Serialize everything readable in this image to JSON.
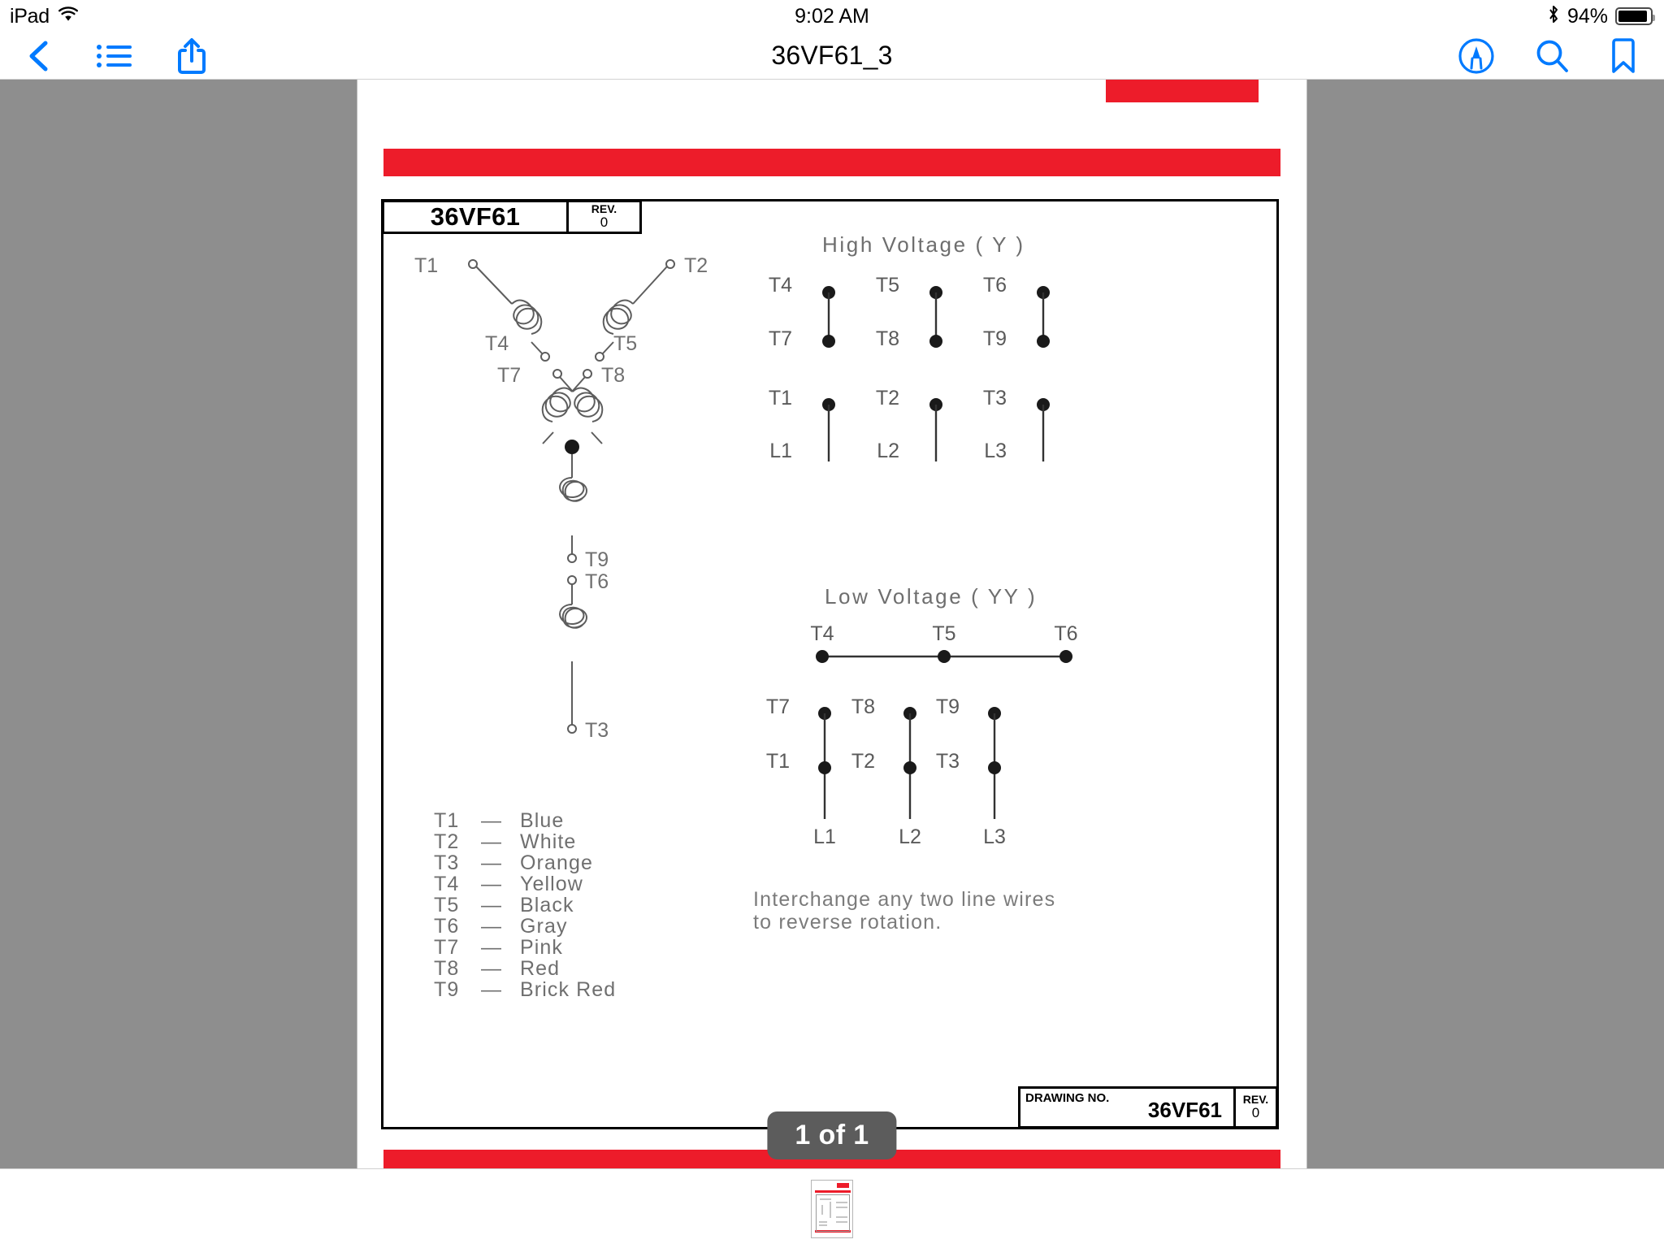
{
  "status_bar": {
    "carrier": "iPad",
    "wifi_icon": "wifi-icon",
    "time": "9:02 AM",
    "bluetooth_icon": "bluetooth-icon",
    "battery_percent": "94%",
    "battery_icon": "battery-icon"
  },
  "toolbar": {
    "back_icon": "back-chevron-icon",
    "thumbnails_icon": "list-icon",
    "share_icon": "share-icon",
    "title": "36VF61_3",
    "markup_icon": "markup-pen-icon",
    "search_icon": "search-icon",
    "bookmark_icon": "bookmark-icon",
    "accent_color": "#007AFF"
  },
  "document": {
    "page_indicator": "1 of 1",
    "banner_color": "#ED1C2A",
    "title_block_top": {
      "name": "36VF61",
      "rev_label": "REV.",
      "rev_value": "0"
    },
    "title_block_bottom": {
      "drawing_no_label": "DRAWING NO.",
      "drawing_no_value": "36VF61",
      "rev_label": "REV.",
      "rev_value": "0"
    },
    "schematic": {
      "winding_terminals": [
        "T1",
        "T4",
        "T7",
        "T2",
        "T5",
        "T8",
        "T9",
        "T6",
        "T3"
      ],
      "high_voltage": {
        "heading": "High  Voltage  (  Y  )",
        "top_pairs": [
          {
            "upper": "T4",
            "lower": "T7"
          },
          {
            "upper": "T5",
            "lower": "T8"
          },
          {
            "upper": "T6",
            "lower": "T9"
          }
        ],
        "line_pairs": [
          {
            "terminal": "T1",
            "line": "L1"
          },
          {
            "terminal": "T2",
            "line": "L2"
          },
          {
            "terminal": "T3",
            "line": "L3"
          }
        ]
      },
      "low_voltage": {
        "heading": "Low  Voltage  (  YY  )",
        "bus_terminals": [
          "T4",
          "T5",
          "T6"
        ],
        "line_pairs": [
          {
            "upper": "T7",
            "lower": "T1",
            "line": "L1"
          },
          {
            "upper": "T8",
            "lower": "T2",
            "line": "L2"
          },
          {
            "upper": "T9",
            "lower": "T3",
            "line": "L3"
          }
        ]
      },
      "note_line_1": "Interchange  any  two  line  wires",
      "note_line_2": "to  reverse  rotation."
    },
    "wire_legend": [
      {
        "terminal": "T1",
        "dash": "—",
        "color": "Blue"
      },
      {
        "terminal": "T2",
        "dash": "—",
        "color": "White"
      },
      {
        "terminal": "T3",
        "dash": "—",
        "color": "Orange"
      },
      {
        "terminal": "T4",
        "dash": "—",
        "color": "Yellow"
      },
      {
        "terminal": "T5",
        "dash": "—",
        "color": "Black"
      },
      {
        "terminal": "T6",
        "dash": "—",
        "color": "Gray"
      },
      {
        "terminal": "T7",
        "dash": "—",
        "color": "Pink"
      },
      {
        "terminal": "T8",
        "dash": "—",
        "color": "Red"
      },
      {
        "terminal": "T9",
        "dash": "—",
        "color": "Brick Red"
      }
    ]
  },
  "thumbnail_strip": {
    "thumb_label": "page-thumbnail-1"
  }
}
